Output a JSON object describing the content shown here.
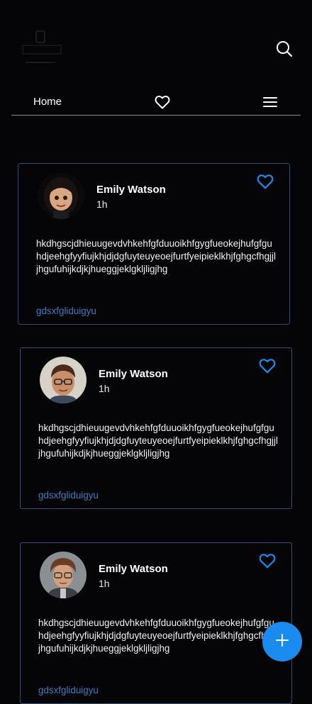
{
  "header": {
    "logo_icon": "brand-logo",
    "search_icon": "search-icon"
  },
  "nav": {
    "home_label": "Home",
    "favorites_icon": "heart-icon",
    "menu_icon": "menu-icon"
  },
  "posts": [
    {
      "author": "Emily Watson",
      "time": "1h",
      "text": "hkdhgscjdhieuugevdvhkehfgfduuoikhfgygfueokejhufgfguhdjeehgfyyfiujkhjdjdgfuyteuyeoejfurtfyeipieklkhjfghgcfhgjjljhgufuhijkdjkjhueggjeklgkljligjhg",
      "tag": "gdsxfgliduigyu"
    },
    {
      "author": "Emily Watson",
      "time": "1h",
      "text": "hkdhgscjdhieuugevdvhkehfgfduuoikhfgygfueokejhufgfguhdjeehgfyyfiujkhjdjdgfuyteuyeoejfurtfyeipieklkhjfghgcfhgjjljhgufuhijkdjkjhueggjeklgkljligjhg",
      "tag": "gdsxfgliduigyu"
    },
    {
      "author": "Emily Watson",
      "time": "1h",
      "text": "hkdhgscjdhieuugevdvhkehfgfduuoikhfgygfueokejhufgfguhdjeehgfyyfiujkhjdjdgfuyteuyeoejfurtfyeipieklkhjfghgcfhgjjljhgufuhijkdjkjhueggjeklgkljligjhg",
      "tag": "gdsxfgliduigyu"
    }
  ],
  "fab": {
    "icon": "plus-icon"
  },
  "colors": {
    "background": "#050507",
    "accent": "#1a8cf0",
    "card_border": "#2d4f7a",
    "tag": "#3c7dc0"
  }
}
